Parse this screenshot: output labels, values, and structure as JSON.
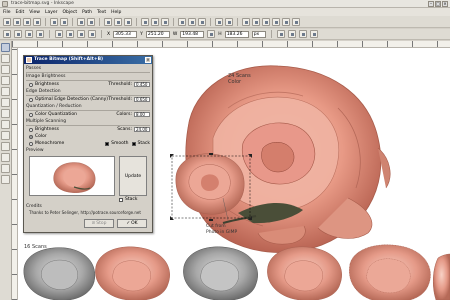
{
  "window": {
    "title": "trace-bitmap.svg - Inkscape"
  },
  "menu": [
    "File",
    "Edit",
    "View",
    "Layer",
    "Object",
    "Path",
    "Text",
    "Help"
  ],
  "controls": {
    "x_label": "X",
    "x_value": "305.33",
    "y_label": "Y",
    "y_value": "251.20",
    "w_label": "W",
    "w_value": "193.48",
    "h_label": "H",
    "h_value": "183.26",
    "unit": "px"
  },
  "canvas": {
    "label_24_line1": "24 Scans",
    "label_24_line2": "Color",
    "label_cut_line1": "Cut from",
    "label_cut_line2": "Photo in GIMP",
    "label_16": "16 Scans"
  },
  "dialog": {
    "title": "Trace Bitmap (Shift+Alt+B)",
    "sections": {
      "passes": "Passes",
      "brightness": "Image Brightness",
      "edge": "Edge Detection",
      "quant": "Quantization / Reduction",
      "multi": "Multiple Scanning",
      "preview": "Preview",
      "credits": "Credits"
    },
    "rows": {
      "brightness": "Brightness",
      "threshold_label": "Threshold:",
      "threshold_value": "0.450",
      "edge": "Optimal Edge Detection (Canny)",
      "edge_threshold_label": "Threshold:",
      "edge_threshold_value": "0.650",
      "quant": "Color Quantization",
      "colors_label": "Colors:",
      "colors_value": "8.00",
      "multi_brightness": "Brightness",
      "scans_label": "Scans:",
      "scans_value": "24.00",
      "color": "Color",
      "mono": "Monochrome",
      "smooth": "Smooth",
      "stack": "Stack",
      "update": "Update",
      "stack2": "Stack"
    },
    "credits_text": "Thanks to Peter Selinger, http://potrace.sourceforge.net",
    "stop_label": "Stop",
    "ok_label": "OK"
  }
}
